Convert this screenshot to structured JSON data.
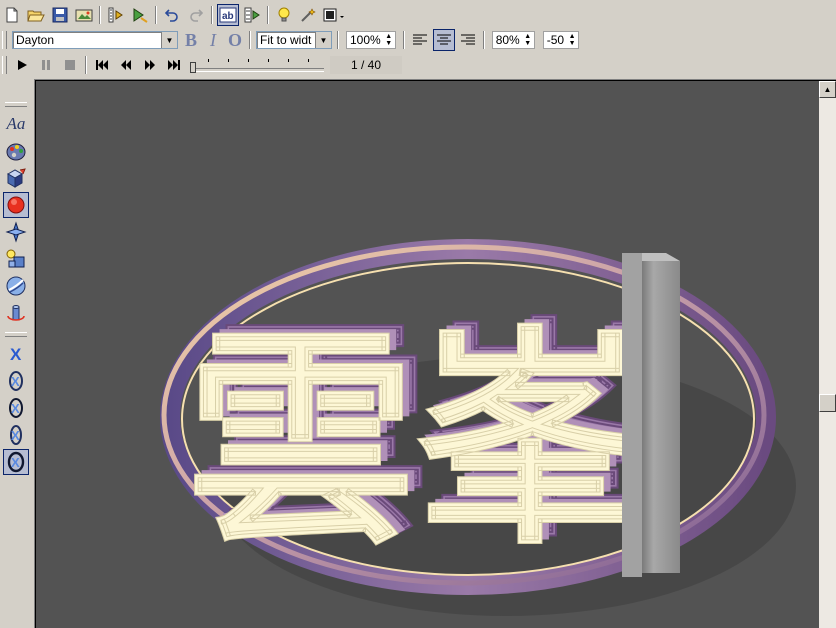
{
  "format_bar": {
    "font_name": "Dayton",
    "bold_label": "B",
    "italic_label": "I",
    "outline_label": "O",
    "fit_mode": "Fit to widt",
    "zoom": "100%",
    "char_spacing": "80%",
    "line_spacing": "-50"
  },
  "playback": {
    "frame_counter": "1 / 40",
    "slider_position": 0.0
  },
  "scene": {
    "text_glyphs": "雲峯",
    "ring_colors": [
      "#f0d0a0",
      "#8a6a9a"
    ],
    "glyph_face_color": "#fdf7d6",
    "glyph_side_color": "#9a78a8",
    "background": "#535353",
    "pillar_color": "#9a9a9a"
  },
  "left_tools": {
    "text_tool": "Aa"
  }
}
